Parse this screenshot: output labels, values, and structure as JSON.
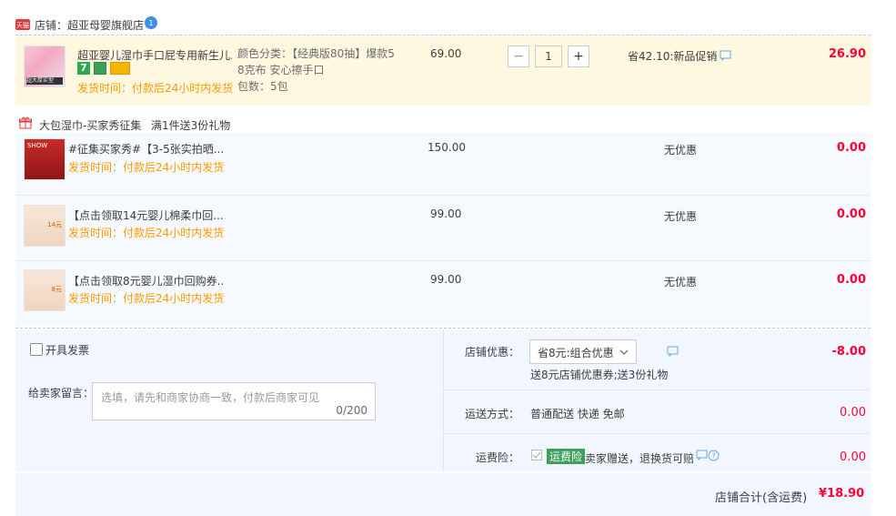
{
  "shop": {
    "label": "店铺：超亚母婴旗舰店",
    "badge": "天猫",
    "ww_count": "1"
  },
  "main_item": {
    "title": "超亚婴儿湿巾手口屁专用新生儿...",
    "ship": "发货时间：付款后24小时内发货",
    "sku_line1": "颜色分类：【经典版80抽】爆款5",
    "sku_line2": "8克布 安心擦手口",
    "sku_line3": "包数：5包",
    "price": "69.00",
    "qty": "1",
    "promo": "省42.10:新品促销",
    "total": "26.90",
    "thumb_label": "超大厚实型"
  },
  "gift_header": {
    "title": "大包湿巾-买家秀征集",
    "rule": "满1件送3份礼物"
  },
  "gifts": [
    {
      "title": "#征集买家秀#【3-5张实拍晒...",
      "ship": "发货时间：付款后24小时内发货",
      "price": "150.00",
      "promo": "无优惠",
      "total": "0.00",
      "thumb_text": "SHOW"
    },
    {
      "title": "【点击领取14元婴儿棉柔巾回...",
      "ship": "发货时间：付款后24小时内发货",
      "price": "99.00",
      "promo": "无优惠",
      "total": "0.00",
      "thumb_text": "14元"
    },
    {
      "title": "【点击领取8元婴儿湿巾回购券...",
      "ship": "发货时间：付款后24小时内发货",
      "price": "99.00",
      "promo": "无优惠",
      "total": "0.00",
      "thumb_text": "8元"
    }
  ],
  "invoice": {
    "label": "开具发票"
  },
  "message": {
    "label": "给卖家留言：",
    "placeholder": "选填，请先和商家协商一致，付款后商家可见",
    "counter": "0/200"
  },
  "discount": {
    "label": "店铺优惠：",
    "selected": "省8元:组合优惠",
    "note": "送8元店铺优惠券;送3份礼物",
    "amount": "-8.00"
  },
  "shipping": {
    "label": "运送方式：",
    "value": "普通配送 快递 免邮",
    "amount": "0.00"
  },
  "insurance": {
    "label": "运费险：",
    "badge": "运费险",
    "desc": "卖家赠送，退换货可赔",
    "amount": "0.00"
  },
  "summary": {
    "label": "店铺合计(含运费)",
    "amount": "¥18.90"
  },
  "colors": {
    "accent": "#ff0036",
    "orange": "#ff9900",
    "green": "#3aa05a",
    "blue": "#1a78d6"
  }
}
